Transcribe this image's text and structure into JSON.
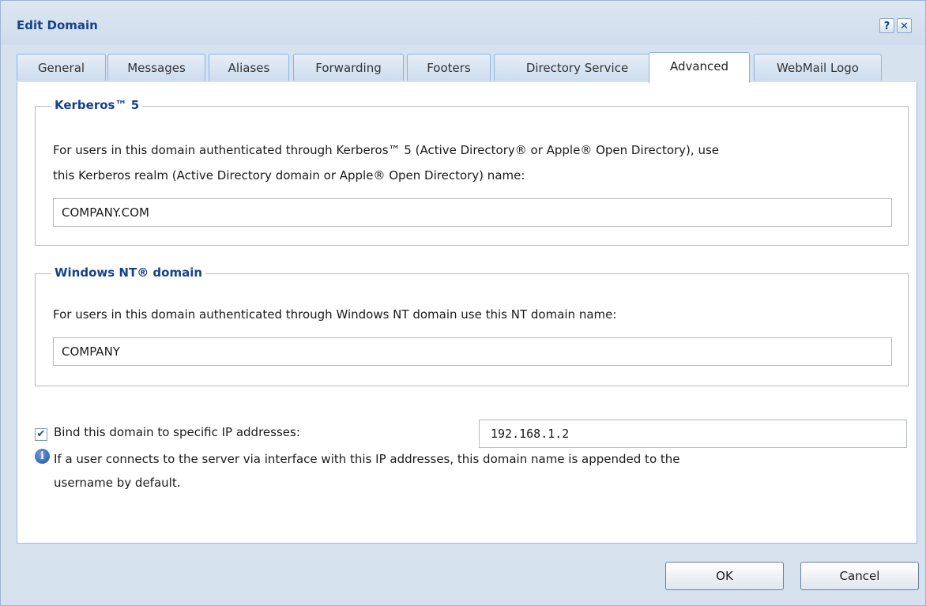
{
  "dialog": {
    "title": "Edit Domain",
    "help_glyph": "?",
    "close_glyph": "✕"
  },
  "tabs": [
    {
      "label": "General"
    },
    {
      "label": "Messages"
    },
    {
      "label": "Aliases"
    },
    {
      "label": "Forwarding"
    },
    {
      "label": "Footers"
    },
    {
      "label": "Directory Service"
    },
    {
      "label": "Advanced",
      "active": true
    },
    {
      "label": "WebMail Logo"
    }
  ],
  "kerberos": {
    "legend": "Kerberos™ 5",
    "description_line1": "For users in this domain authenticated through Kerberos™ 5 (Active Directory® or Apple® Open Directory), use",
    "description_line2": "this Kerberos realm (Active Directory domain or Apple® Open Directory) name:",
    "realm_value": "COMPANY.COM"
  },
  "nt_domain": {
    "legend": "Windows NT® domain",
    "description": "For users in this domain authenticated through Windows NT domain use this NT domain name:",
    "domain_value": "COMPANY"
  },
  "bind_ip": {
    "checked": true,
    "check_glyph": "✔",
    "label": "Bind this domain to specific IP addresses:",
    "value": "192.168.1.2"
  },
  "info": {
    "icon": "info-icon",
    "icon_glyph": "i",
    "line1": "If a user connects to the server via interface with this IP addresses, this domain name is appended to the",
    "line2": "username by default."
  },
  "buttons": {
    "ok_label": "OK",
    "cancel_label": "Cancel"
  }
}
